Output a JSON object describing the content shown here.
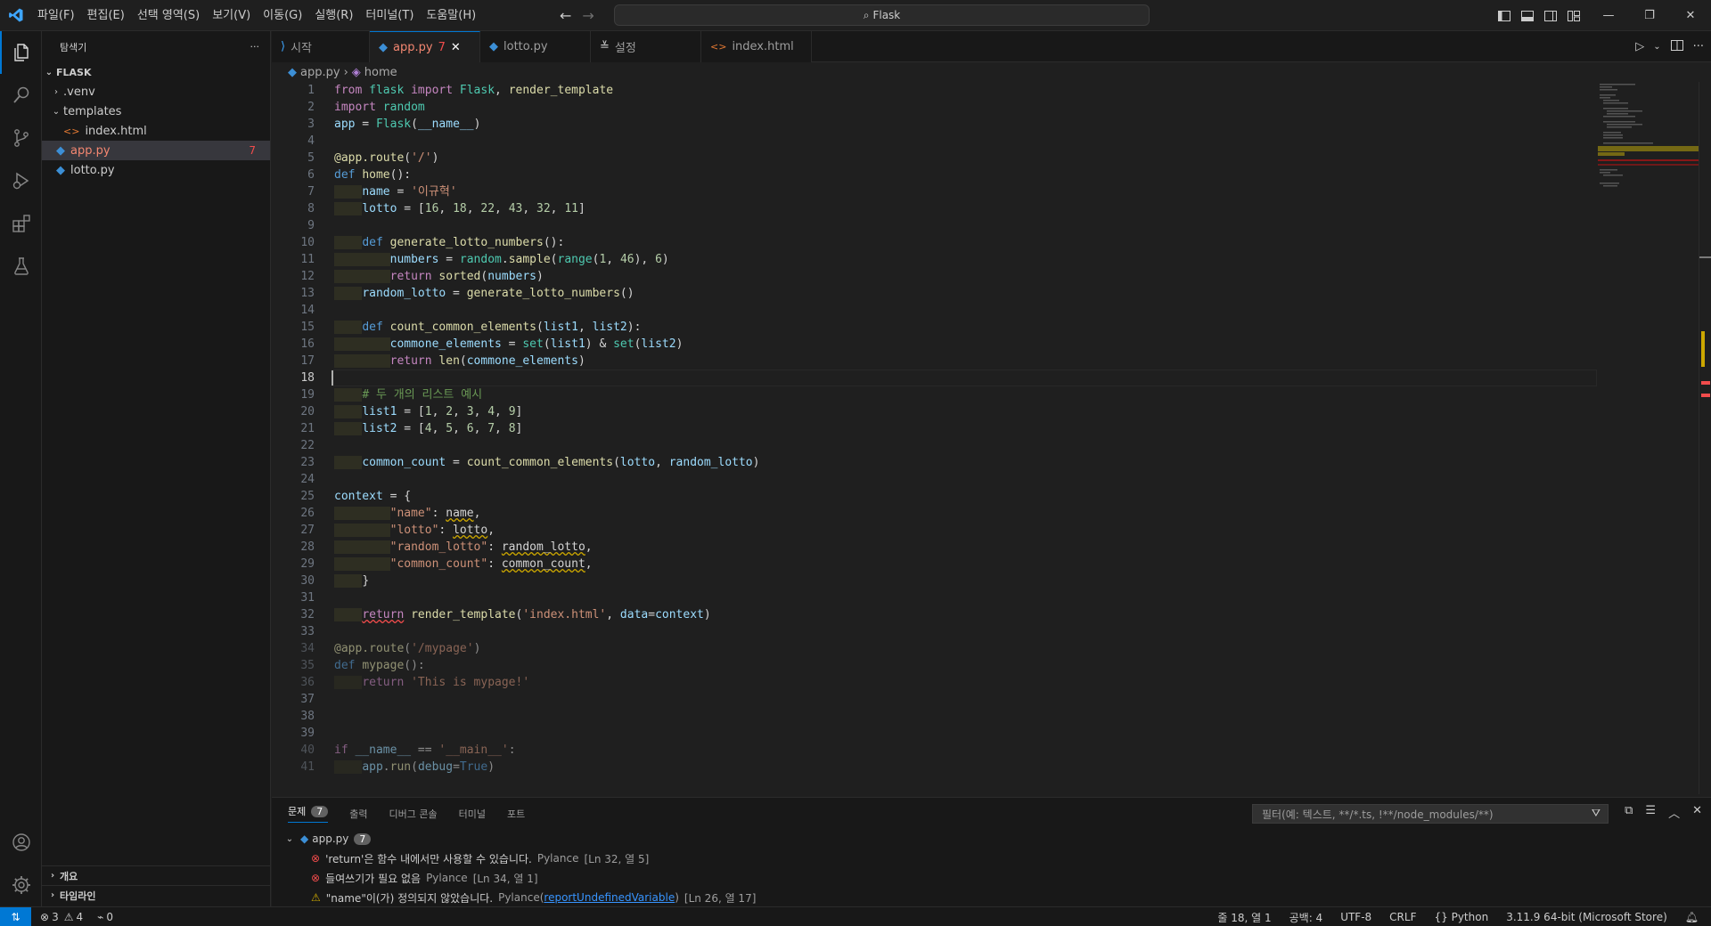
{
  "titlebar": {
    "menus": [
      "파일(F)",
      "편집(E)",
      "선택 영역(S)",
      "보기(V)",
      "이동(G)",
      "실행(R)",
      "터미널(T)",
      "도움말(H)"
    ],
    "search": "Flask",
    "colors": {
      "accent": "#0078d4"
    }
  },
  "sidebar": {
    "title": "탐색기",
    "root": "FLASK",
    "items": [
      {
        "label": ".venv",
        "type": "folder",
        "expanded": false,
        "indent": 1
      },
      {
        "label": "templates",
        "type": "folder",
        "expanded": true,
        "indent": 1
      },
      {
        "label": "index.html",
        "type": "html",
        "indent": 2
      },
      {
        "label": "app.py",
        "type": "python",
        "indent": 1,
        "badge": "7",
        "selected": true
      },
      {
        "label": "lotto.py",
        "type": "python",
        "indent": 1
      }
    ],
    "outline": "개요",
    "timeline": "타임라인"
  },
  "tabs": [
    {
      "label": "시작",
      "icon": "vscode-icon"
    },
    {
      "label": "app.py",
      "badge": "7",
      "active": true,
      "icon": "python-icon"
    },
    {
      "label": "lotto.py",
      "icon": "python-icon"
    },
    {
      "label": "설정",
      "icon": "settings-icon"
    },
    {
      "label": "index.html",
      "icon": "html-icon"
    }
  ],
  "breadcrumb": {
    "file": "app.py",
    "symbol": "home"
  },
  "editor": {
    "current_line": 18
  },
  "panel": {
    "tabs": [
      "문제",
      "출력",
      "디버그 콘솔",
      "터미널",
      "포트"
    ],
    "problem_count": "7",
    "filter_placeholder": "필터(예: 텍스트, **/*.ts, !**/node_modules/**)",
    "group": {
      "file": "app.py",
      "count": "7"
    },
    "problems": [
      {
        "severity": "error",
        "message": "'return'은 함수 내에서만 사용할 수 있습니다.",
        "source": "Pylance",
        "position": "[Ln 32, 열 5]"
      },
      {
        "severity": "error",
        "message": "들여쓰기가 필요 없음",
        "source": "Pylance",
        "position": "[Ln 34, 열 1]"
      },
      {
        "severity": "warning",
        "message": "\"name\"이(가) 정의되지 않았습니다.",
        "source": "Pylance",
        "link": "reportUndefinedVariable",
        "position": "[Ln 26, 열 17]"
      }
    ]
  },
  "statusbar": {
    "errors": "3",
    "warnings": "4",
    "ports": "0",
    "position": "줄 18, 열 1",
    "spaces": "공백: 4",
    "encoding": "UTF-8",
    "eol": "CRLF",
    "language": "Python",
    "interpreter": "3.11.9 64-bit (Microsoft Store)"
  }
}
